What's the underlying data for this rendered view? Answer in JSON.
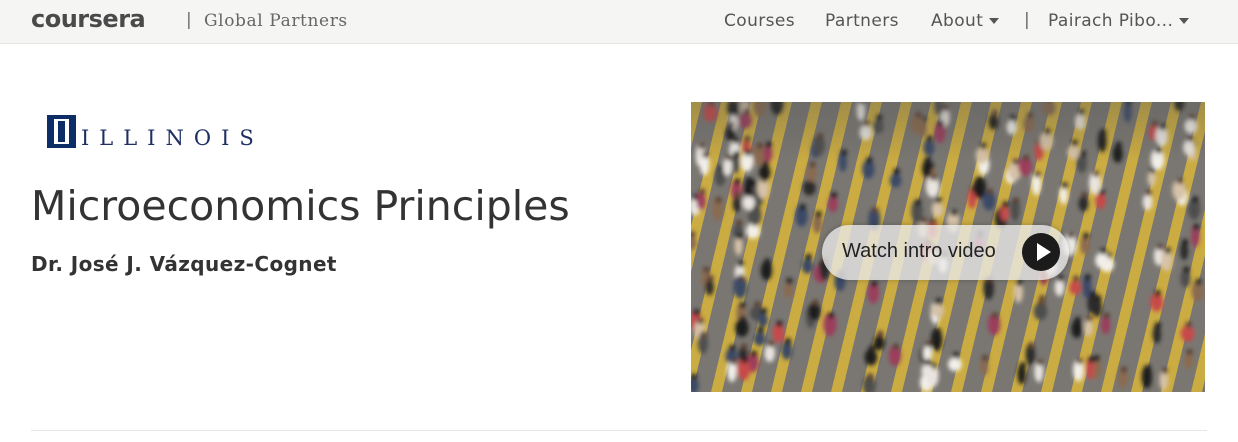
{
  "header": {
    "brand": "coursera",
    "separator": "|",
    "subtitle": "Global Partners",
    "nav": {
      "courses": "Courses",
      "partners": "Partners",
      "about": "About",
      "separator": "|",
      "user": "Pairach Pibo..."
    }
  },
  "course": {
    "university": "ILLINOIS",
    "title": "Microeconomics Principles",
    "instructor": "Dr. José J. Vázquez-Cognet"
  },
  "video": {
    "button_label": "Watch intro video",
    "icon": "play-icon"
  },
  "colors": {
    "topbar_bg": "#f5f5f4",
    "illinois_blue": "#0d2d66",
    "crosswalk_yellow": "#d9b53a"
  }
}
